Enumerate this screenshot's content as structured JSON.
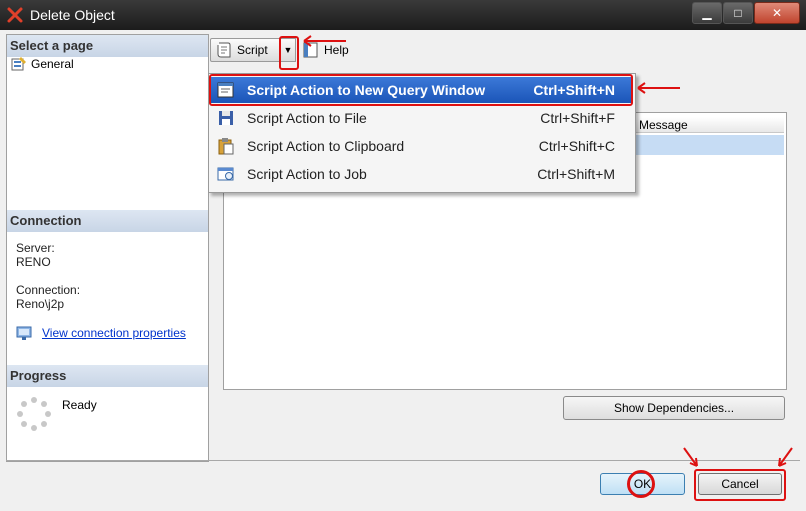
{
  "window": {
    "title": "Delete Object"
  },
  "left": {
    "select_page_header": "Select a page",
    "pages": [
      {
        "label": "General"
      }
    ],
    "connection_header": "Connection",
    "server_label": "Server:",
    "server_value": "RENO",
    "connection_label": "Connection:",
    "connection_value": "Reno\\j2p",
    "view_props_link": "View connection properties",
    "progress_header": "Progress",
    "progress_status": "Ready"
  },
  "toolbar": {
    "script_label": "Script",
    "help_label": "Help"
  },
  "script_menu": {
    "items": [
      {
        "label": "Script Action to New Query Window",
        "shortcut": "Ctrl+Shift+N",
        "icon": "query-window-icon"
      },
      {
        "label": "Script Action to File",
        "shortcut": "Ctrl+Shift+F",
        "icon": "floppy-disk-icon"
      },
      {
        "label": "Script Action to Clipboard",
        "shortcut": "Ctrl+Shift+C",
        "icon": "clipboard-icon"
      },
      {
        "label": "Script Action to Job",
        "shortcut": "Ctrl+Shift+M",
        "icon": "job-icon"
      }
    ]
  },
  "grid": {
    "message_header": "Message"
  },
  "buttons": {
    "show_dependencies": "Show Dependencies...",
    "ok": "OK",
    "cancel": "Cancel"
  },
  "colors": {
    "highlight": "#1b55b8",
    "annotation": "#dd1111",
    "section_header": "#c8d5e6"
  }
}
